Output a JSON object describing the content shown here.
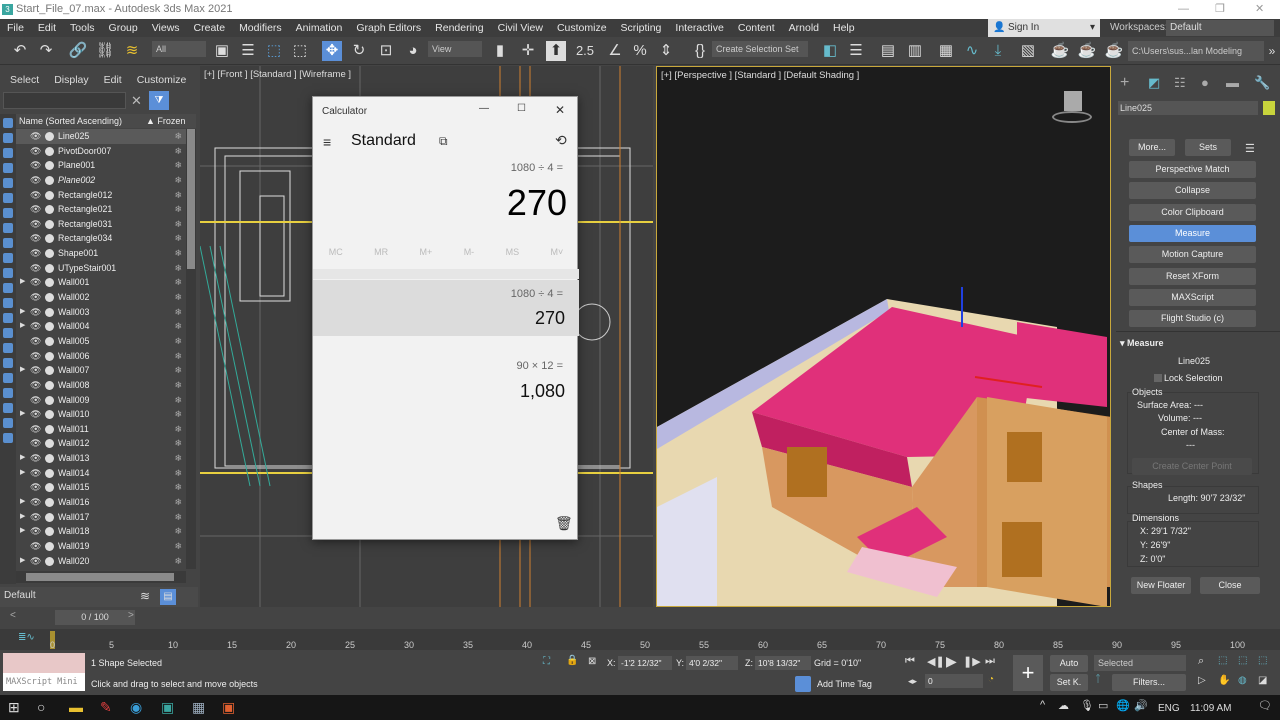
{
  "window": {
    "title": "Start_File_07.max - Autodesk 3ds Max 2021",
    "app_icon": "3"
  },
  "menu": [
    "File",
    "Edit",
    "Tools",
    "Group",
    "Views",
    "Create",
    "Modifiers",
    "Animation",
    "Graph Editors",
    "Rendering",
    "Civil View",
    "Customize",
    "Scripting",
    "Interactive",
    "Content",
    "Arnold",
    "Help"
  ],
  "account": {
    "sign_in": "Sign In",
    "workspaces_label": "Workspaces:",
    "workspace": "Default"
  },
  "toolbar": {
    "filter": "All",
    "ref_coord": "View",
    "selection_set": "Create Selection Set",
    "project_path": "C:\\Users\\sus...lan Modeling",
    "snap_label": "2.5"
  },
  "scene_explorer": {
    "menu": [
      "Select",
      "Display",
      "Edit",
      "Customize"
    ],
    "search_value": "",
    "col_name": "Name (Sorted Ascending)",
    "col_frozen": "▲ Frozen",
    "rows": [
      {
        "name": "Line025",
        "selected": true,
        "expand": false,
        "italic": false
      },
      {
        "name": "PivotDoor007",
        "expand": false
      },
      {
        "name": "Plane001",
        "expand": false
      },
      {
        "name": "Plane002",
        "expand": false,
        "italic": true
      },
      {
        "name": "Rectangle012",
        "expand": false
      },
      {
        "name": "Rectangle021",
        "expand": false
      },
      {
        "name": "Rectangle031",
        "expand": false
      },
      {
        "name": "Rectangle034",
        "expand": false
      },
      {
        "name": "Shape001",
        "expand": false
      },
      {
        "name": "UTypeStair001",
        "expand": false
      },
      {
        "name": "Wall001",
        "expand": true
      },
      {
        "name": "Wall002",
        "expand": false
      },
      {
        "name": "Wall003",
        "expand": true
      },
      {
        "name": "Wall004",
        "expand": true
      },
      {
        "name": "Wall005",
        "expand": false
      },
      {
        "name": "Wall006",
        "expand": false
      },
      {
        "name": "Wall007",
        "expand": true
      },
      {
        "name": "Wall008",
        "expand": false
      },
      {
        "name": "Wall009",
        "expand": false
      },
      {
        "name": "Wall010",
        "expand": true
      },
      {
        "name": "Wall011",
        "expand": false
      },
      {
        "name": "Wall012",
        "expand": false
      },
      {
        "name": "Wall013",
        "expand": true
      },
      {
        "name": "Wall014",
        "expand": true
      },
      {
        "name": "Wall015",
        "expand": false
      },
      {
        "name": "Wall016",
        "expand": true
      },
      {
        "name": "Wall017",
        "expand": true
      },
      {
        "name": "Wall018",
        "expand": true
      },
      {
        "name": "Wall019",
        "expand": false
      },
      {
        "name": "Wall020",
        "expand": true
      }
    ],
    "layer": "Default"
  },
  "viewports": {
    "front": "[+] [Front ] [Standard ] [Wireframe ]",
    "perspective": "[+] [Perspective ] [Standard ] [Default Shading ]"
  },
  "calculator": {
    "title": "Calculator",
    "mode": "Standard",
    "expression": "1080 ÷ 4 =",
    "display": "270",
    "memory": [
      "MC",
      "MR",
      "M+",
      "M-",
      "MS",
      "M˅"
    ],
    "history": [
      {
        "expr": "1080   ÷   4 =",
        "result": "270"
      },
      {
        "expr": "90   ×   12 =",
        "result": "1,080"
      }
    ]
  },
  "command_panel": {
    "object_name": "Line025",
    "object_color": "#c8d43c",
    "buttons": [
      "More...",
      "Sets",
      "Perspective Match",
      "Collapse",
      "Color Clipboard",
      "Measure",
      "Motion Capture",
      "Reset XForm",
      "MAXScript",
      "Flight Studio (c)"
    ],
    "active_button": "Measure",
    "measure": {
      "title": "Measure",
      "name": "Line025",
      "lock_selection": "Lock Selection",
      "objects_label": "Objects",
      "surface_area": "Surface Area: ---",
      "volume": "Volume: ---",
      "center_of_mass": "Center of Mass:",
      "com_value": "---",
      "create_center": "Create Center Point",
      "shapes_label": "Shapes",
      "length": "Length:  90'7 23/32\"",
      "dimensions_label": "Dimensions",
      "x": "X:   29'1 7/32\"",
      "y": "Y:   26'9\"",
      "z": "Z:   0'0\"",
      "new_floater": "New Floater",
      "close": "Close"
    }
  },
  "timeline": {
    "slider": "0 / 100",
    "ticks": [
      "0",
      "5",
      "10",
      "15",
      "20",
      "25",
      "30",
      "35",
      "40",
      "45",
      "50",
      "55",
      "60",
      "65",
      "70",
      "75",
      "80",
      "85",
      "90",
      "95",
      "100"
    ]
  },
  "status": {
    "maxscript": "MAXScript Mini",
    "selection": "1 Shape Selected",
    "prompt": "Click and drag to select and move objects",
    "x": "-1'2 12/32\"",
    "y": "4'0 2/32\"",
    "z": "10'8 13/32\"",
    "grid": "Grid = 0'10\"",
    "add_time_tag": "Add Time Tag",
    "frame": "0",
    "auto": "Auto",
    "set_key": "Set K.",
    "key_filter": "Selected",
    "filters": "Filters..."
  },
  "taskbar": {
    "lang": "ENG",
    "time": "11:09 AM"
  }
}
